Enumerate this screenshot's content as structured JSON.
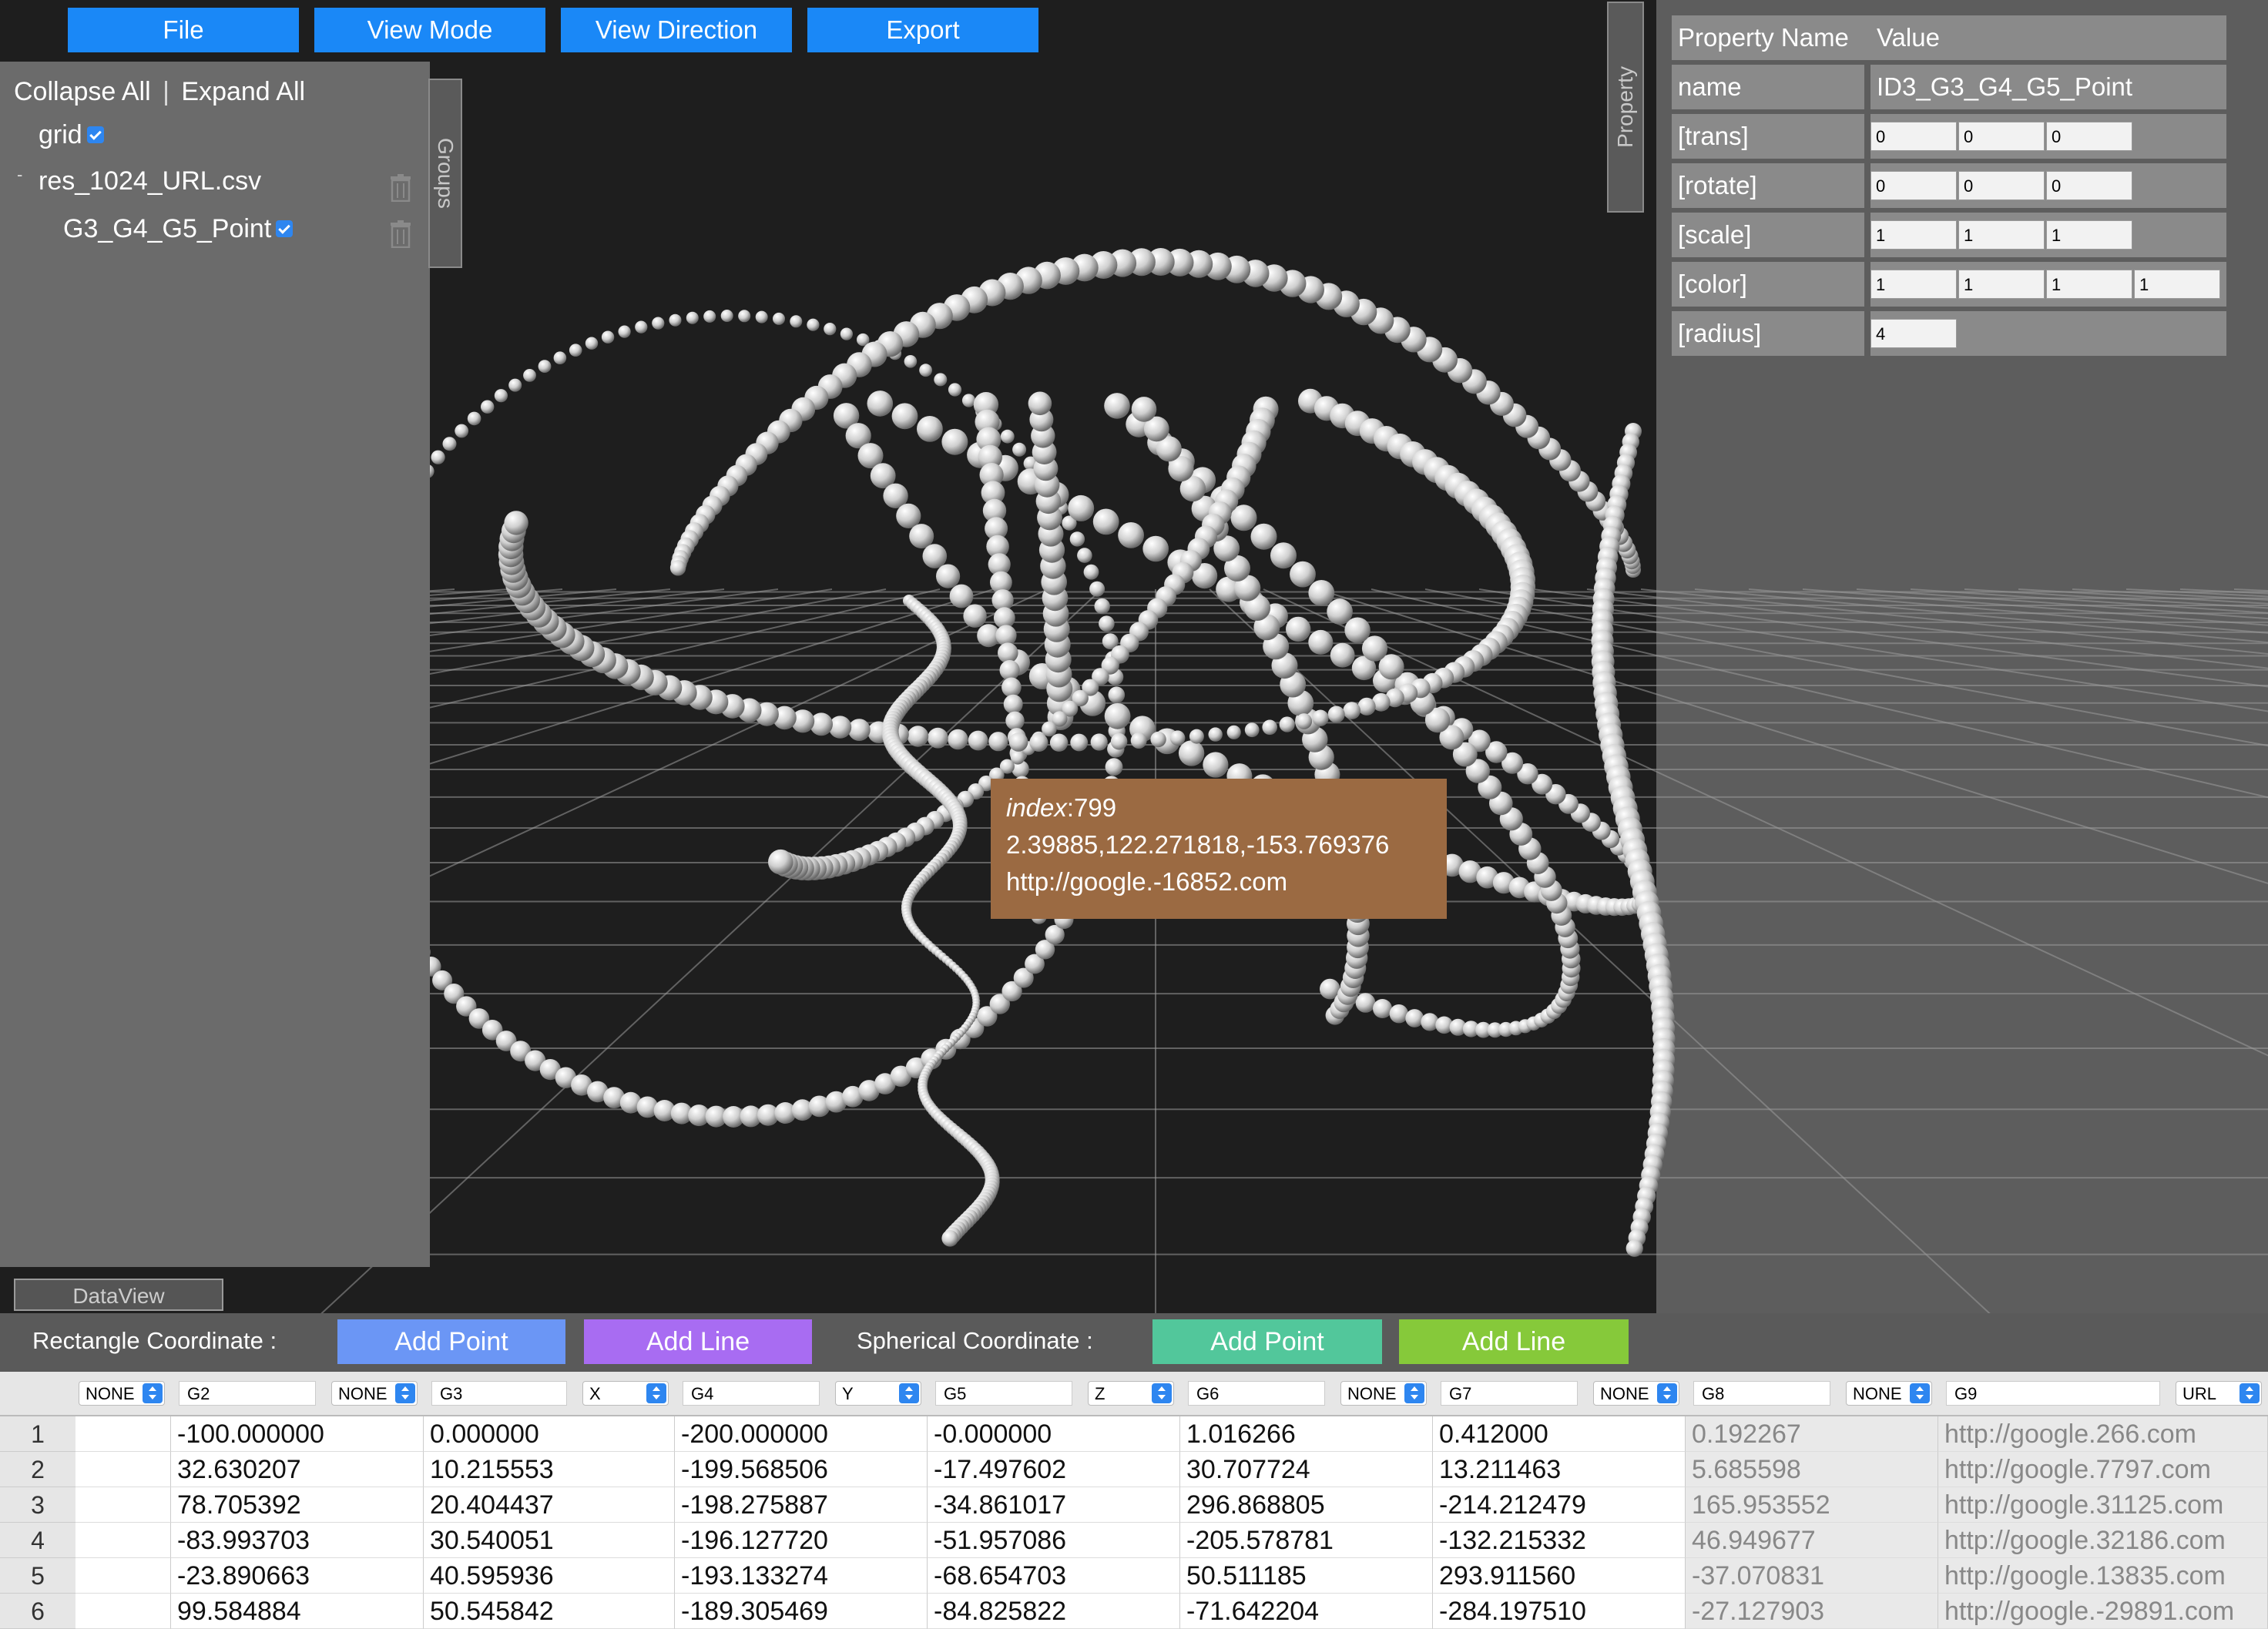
{
  "menu": [
    "File",
    "View Mode",
    "View Direction",
    "Export"
  ],
  "groups": {
    "collapse_all": "Collapse All",
    "separator": "|",
    "expand_all": "Expand All",
    "items": [
      {
        "label": "grid",
        "checked": true
      },
      {
        "label": "res_1024_URL.csv",
        "expander": "-"
      },
      {
        "label": "G3_G4_G5_Point",
        "checked": true
      }
    ],
    "tab_label": "Groups"
  },
  "property": {
    "tab_label": "Property",
    "header_name": "Property Name",
    "header_value": "Value",
    "name_label": "name",
    "name_value": "ID3_G3_G4_G5_Point",
    "rows": [
      {
        "label": "[trans]",
        "values": [
          "0",
          "0",
          "0"
        ]
      },
      {
        "label": "[rotate]",
        "values": [
          "0",
          "0",
          "0"
        ]
      },
      {
        "label": "[scale]",
        "values": [
          "1",
          "1",
          "1"
        ]
      },
      {
        "label": "[color]",
        "values": [
          "1",
          "1",
          "1",
          "1"
        ]
      },
      {
        "label": "[radius]",
        "values": [
          "4"
        ]
      }
    ]
  },
  "tooltip": {
    "index_label": "index",
    "index_value": ":799",
    "coords": "2.39885,122.271818,-153.769376",
    "url": "http://google.-16852.com"
  },
  "dataview": {
    "tab_label": "DataView",
    "rect_label": "Rectangle Coordinate :",
    "rect_add_point": "Add Point",
    "rect_add_line": "Add Line",
    "sph_label": "Spherical Coordinate :",
    "sph_add_point": "Add Point",
    "sph_add_line": "Add Line"
  },
  "colors": {
    "menu": "#1a88f7",
    "rect_point": "#6b96f5",
    "rect_line": "#a86cf2",
    "sph_point": "#52c79b",
    "sph_line": "#86c93a",
    "tooltip": "#9b6a42"
  },
  "table": {
    "columns": [
      {
        "name": "",
        "type": "NONE"
      },
      {
        "name": "G2",
        "type": "NONE"
      },
      {
        "name": "G3",
        "type": "X"
      },
      {
        "name": "G4",
        "type": "Y"
      },
      {
        "name": "G5",
        "type": "Z"
      },
      {
        "name": "G6",
        "type": "NONE"
      },
      {
        "name": "G7",
        "type": "NONE"
      },
      {
        "name": "G8",
        "type": "NONE"
      },
      {
        "name": "G9",
        "type": "URL"
      }
    ],
    "rows": [
      [
        "1",
        "-100.000000",
        "0.000000",
        "-200.000000",
        "-0.000000",
        "1.016266",
        "0.412000",
        "0.192267",
        "http://google.266.com"
      ],
      [
        "2",
        "32.630207",
        "10.215553",
        "-199.568506",
        "-17.497602",
        "30.707724",
        "13.211463",
        "5.685598",
        "http://google.7797.com"
      ],
      [
        "3",
        "78.705392",
        "20.404437",
        "-198.275887",
        "-34.861017",
        "296.868805",
        "-214.212479",
        "165.953552",
        "http://google.31125.com"
      ],
      [
        "4",
        "-83.993703",
        "30.540051",
        "-196.127720",
        "-51.957086",
        "-205.578781",
        "-132.215332",
        "46.949677",
        "http://google.32186.com"
      ],
      [
        "5",
        "-23.890663",
        "40.595936",
        "-193.133274",
        "-68.654703",
        "50.511185",
        "293.911560",
        "-37.070831",
        "http://google.13835.com"
      ],
      [
        "6",
        "99.584884",
        "50.545842",
        "-189.305469",
        "-84.825822",
        "-71.642204",
        "-284.197510",
        "-27.127903",
        "http://google.-29891.com"
      ]
    ]
  }
}
